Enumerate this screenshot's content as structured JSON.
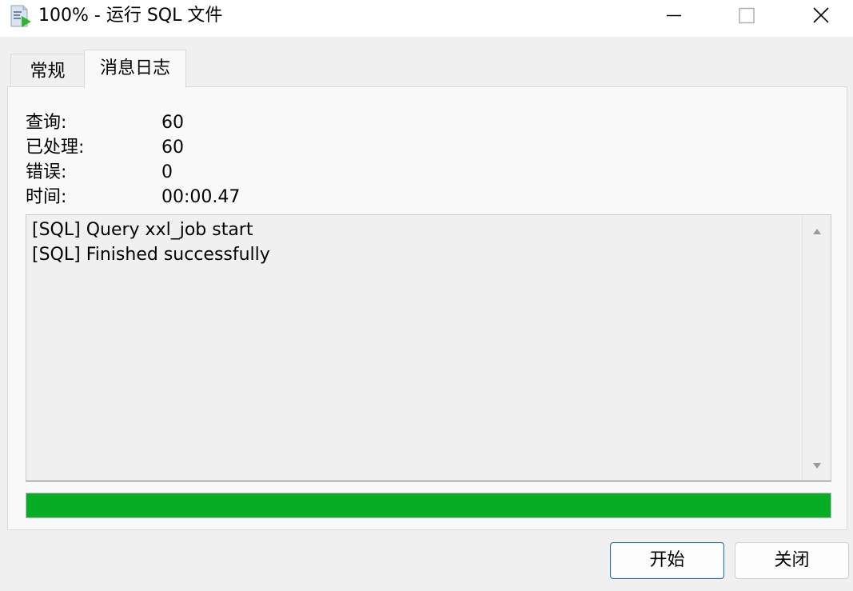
{
  "window": {
    "title": "100% - 运行 SQL 文件",
    "icon": "sql-file-run-icon",
    "controls": [
      "minimize-icon",
      "maximize-icon",
      "close-icon"
    ]
  },
  "tabs": [
    {
      "label": "常规",
      "active": false
    },
    {
      "label": "消息日志",
      "active": true
    }
  ],
  "stats": {
    "queries_label": "查询:",
    "queries_value": "60",
    "processed_label": "已处理:",
    "processed_value": "60",
    "errors_label": "错误:",
    "errors_value": "0",
    "time_label": "时间:",
    "time_value": "00:00.47"
  },
  "log": {
    "lines": [
      "[SQL] Query xxl_job start",
      "[SQL] Finished successfully"
    ]
  },
  "progress": {
    "percent": 100,
    "color": "#06ad25"
  },
  "buttons": {
    "start_label": "开始",
    "close_label": "关闭"
  },
  "colors": {
    "accent_border": "#2b6e9e",
    "progress": "#06ad25"
  }
}
